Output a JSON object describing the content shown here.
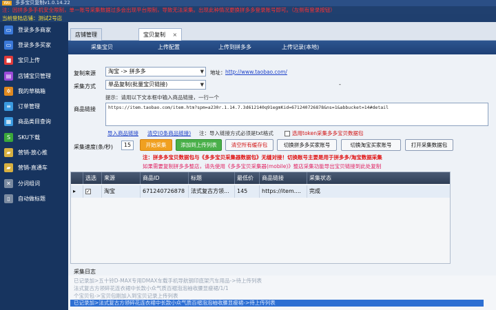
{
  "app": {
    "title": "多多宝贝复制v1.0.14.22",
    "logo_text": "Wo",
    "notice": "注：因拼多多手机安全限制，单一账号采集数据过多会出现平台限制，导致无法采集。出现此种情况更换拼多多登录账号即可。（左侧有登录按钮）",
    "current_shop": "当前登陆店铺：测试2号店"
  },
  "sidebar": {
    "items": [
      {
        "label": "登录多多商家",
        "icon": "monitor-icon",
        "color": "#3a78d8"
      },
      {
        "label": "登录多多买家",
        "icon": "monitor-icon",
        "color": "#3a78d8"
      },
      {
        "label": "宝贝上传",
        "icon": "gift-icon",
        "color": "#e03a3a"
      },
      {
        "label": "店铺宝贝管理",
        "icon": "store-icon",
        "color": "#9a4ad8"
      },
      {
        "label": "我的草稿箱",
        "icon": "gear-icon",
        "color": "#e08a20"
      },
      {
        "label": "订单管理",
        "icon": "list-icon",
        "color": "#3a9ae0"
      },
      {
        "label": "商品类目查询",
        "icon": "grid-icon",
        "color": "#3a9ae0"
      },
      {
        "label": "SKU下载",
        "icon": "sku-icon",
        "color": "#3aa83a"
      },
      {
        "label": "营销-放心推",
        "icon": "truck-icon",
        "color": "#d8b040"
      },
      {
        "label": "营销-直通车",
        "icon": "truck-icon",
        "color": "#d8b040"
      },
      {
        "label": "分词组词",
        "icon": "tools-icon",
        "color": "#7a8aa0"
      },
      {
        "label": "自动做标题",
        "icon": "doc-icon",
        "color": "#7a8aa0"
      }
    ]
  },
  "tabs": [
    {
      "label": "店铺管理"
    },
    {
      "label": "宝贝复制",
      "close": "×"
    }
  ],
  "subtabs": [
    "采集宝贝",
    "上传配置",
    "上传到拼多多",
    "上传记录(本地)"
  ],
  "form": {
    "source_label": "复制来源",
    "source_value": "淘宝          ->  拼多多",
    "url_label": "地址：",
    "url": "http://www.taobao.com/",
    "method_label": "采集方式",
    "method_value": "单品复制(批量宝贝链接)",
    "method_dash": "-",
    "prompt": "提示：请用以下文本框中输入商品链接，一行一个",
    "link_label": "商品链接",
    "link_value": "https://item.taobao.com/item.htm?spm=a230r.1.14.7.3d612140q91egmKid=671240726878&ns=1&abbucket=14#detail",
    "import_link": "导入商品链接",
    "clear_link": "清空(0条商品链接)",
    "import_note": "注：导入链接方式必须是txt格式",
    "token_label": "选用token采集多多宝贝数据包",
    "speed_label": "采集速度(条/秒)",
    "speed_value": "15",
    "btn_start": "开始采集",
    "btn_add": "添加到上传列表",
    "btn_clear": "清空所有缓存包",
    "btn_switch_pdd": "切换拼多多买家账号",
    "btn_switch_tb": "切换淘宝买家账号",
    "btn_open": "打开采集数据包",
    "warn1": "注：拼多多宝贝数据包与《多多宝贝采集器数据包》无缝对接！切换账号主要是用于拼多多/淘宝数据采集",
    "warn2": "如果需要复制拼多多整店，请先使用《多多宝贝采集器(mobile)》整店采集功能导出宝贝链接到此处复制"
  },
  "grid": {
    "headers": [
      "选选",
      "来源",
      "商品ID",
      "标题",
      "最低价",
      "商品链接",
      "采集状态"
    ],
    "rows": [
      {
        "marker": "▸",
        "check": "✓",
        "source": "淘宝",
        "id": "671240726878",
        "title": "法式复古方领...",
        "price": "145",
        "link": "https://item....",
        "status": "完成"
      }
    ]
  },
  "log": {
    "title": "采集日志",
    "lines": [
      "已记录加>五十铃D-MAX专用DMAX车载手机导航钢印底架汽车用品->待上传列表",
      "法式复古方领碎花连衣裙中长款小众气质百褶泡泡袖收腰显瘦裙/1/1",
      "个宝贝包->宝贝包刚加入到宝贝记录上传列表",
      "已记录加>法式复古方领碎花连衣裙中长款小众气质百褶泡泡袖收腰显瘦裙->待上传列表"
    ]
  }
}
